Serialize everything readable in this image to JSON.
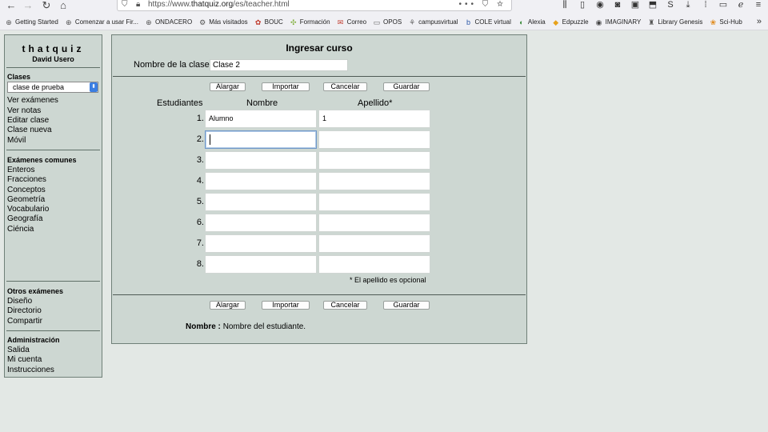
{
  "browser": {
    "url_prefix": "https://www.",
    "url_domain": "thatquiz.org",
    "url_path": "/es/teacher.html",
    "url_actions": "••• ⛉ ☆",
    "bookmarks": [
      {
        "label": "Getting Started",
        "icon": "⊕",
        "color": "#555"
      },
      {
        "label": "Comenzar a usar Fir...",
        "icon": "⊕",
        "color": "#555"
      },
      {
        "label": "ONDACERO",
        "icon": "⊕",
        "color": "#555"
      },
      {
        "label": "Más visitados",
        "icon": "⚙",
        "color": "#555"
      },
      {
        "label": "BOUC",
        "icon": "✿",
        "color": "#c0392b"
      },
      {
        "label": "Formación",
        "icon": "✣",
        "color": "#7fae3a"
      },
      {
        "label": "Correo",
        "icon": "✉",
        "color": "#c0392b"
      },
      {
        "label": "OPOS",
        "icon": "▭",
        "color": "#666"
      },
      {
        "label": "campusvirtual",
        "icon": "⚘",
        "color": "#666"
      },
      {
        "label": "COLE virtual",
        "icon": "b",
        "color": "#2b58a8"
      },
      {
        "label": "Alexia",
        "icon": "◐",
        "color": "#3a8a3a"
      },
      {
        "label": "Edpuzzle",
        "icon": "◆",
        "color": "#e7a21b"
      },
      {
        "label": "IMAGINARY",
        "icon": "◉",
        "color": "#444"
      },
      {
        "label": "Library Genesis",
        "icon": "♜",
        "color": "#555"
      },
      {
        "label": "Sci-Hub",
        "icon": "❀",
        "color": "#e08a1b"
      }
    ]
  },
  "sidebar": {
    "logo": "thatquiz",
    "user": "David Usero",
    "classes_title": "Clases",
    "class_select": "clase de prueba",
    "class_links": [
      "Ver exámenes",
      "Ver notas",
      "Editar clase",
      "Clase nueva",
      "Móvil"
    ],
    "common_title": "Exámenes comunes",
    "common_links": [
      "Enteros",
      "Fracciones",
      "Conceptos",
      "Geometría",
      "Vocabulario",
      "Geografía",
      "Ciéncia"
    ],
    "other_title": "Otros exámenes",
    "other_links": [
      "Diseño",
      "Directorio",
      "Compartir"
    ],
    "admin_title": "Administración",
    "admin_links": [
      "Salida",
      "Mi cuenta",
      "Instrucciones"
    ]
  },
  "main": {
    "title": "Ingresar curso",
    "class_name_label": "Nombre de la clase",
    "class_name_value": "Clase 2",
    "buttons": {
      "alargar": "Alargar",
      "importar": "Importar",
      "cancelar": "Cancelar",
      "guardar": "Guardar"
    },
    "headers": {
      "students": "Estudiantes",
      "first": "Nombre",
      "last": "Apellido*"
    },
    "rows": [
      {
        "num": "1.",
        "first": "Alumno",
        "last": "1"
      },
      {
        "num": "2.",
        "first": "",
        "last": ""
      },
      {
        "num": "3.",
        "first": "",
        "last": ""
      },
      {
        "num": "4.",
        "first": "",
        "last": ""
      },
      {
        "num": "5.",
        "first": "",
        "last": ""
      },
      {
        "num": "6.",
        "first": "",
        "last": ""
      },
      {
        "num": "7.",
        "first": "",
        "last": ""
      },
      {
        "num": "8.",
        "first": "",
        "last": ""
      }
    ],
    "note": "* El apellido es opcional",
    "footer_label": "Nombre :",
    "footer_text": "Nombre del estudiante."
  }
}
